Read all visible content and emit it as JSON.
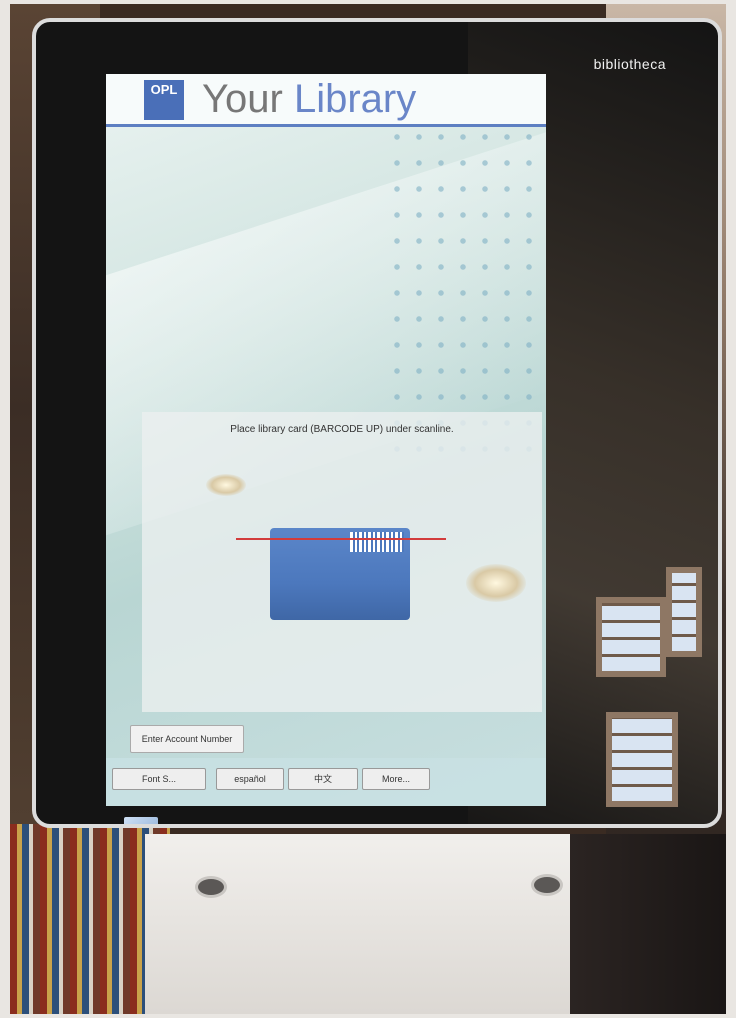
{
  "kiosk": {
    "brand": "bibliotheca",
    "header": {
      "logo_text": "OPL",
      "title_prefix": "Your",
      "title_suffix": "Library"
    },
    "instruction": "Place library card (BARCODE UP) under scanline.",
    "account_button": "Enter Account Number",
    "footer_buttons": {
      "font_size": "Font S...",
      "espanol": "español",
      "chinese": "中文",
      "more": "More..."
    }
  },
  "colors": {
    "accent": "#5d7fc2",
    "scanline": "#d23b3b",
    "card": "#4c78bd"
  }
}
